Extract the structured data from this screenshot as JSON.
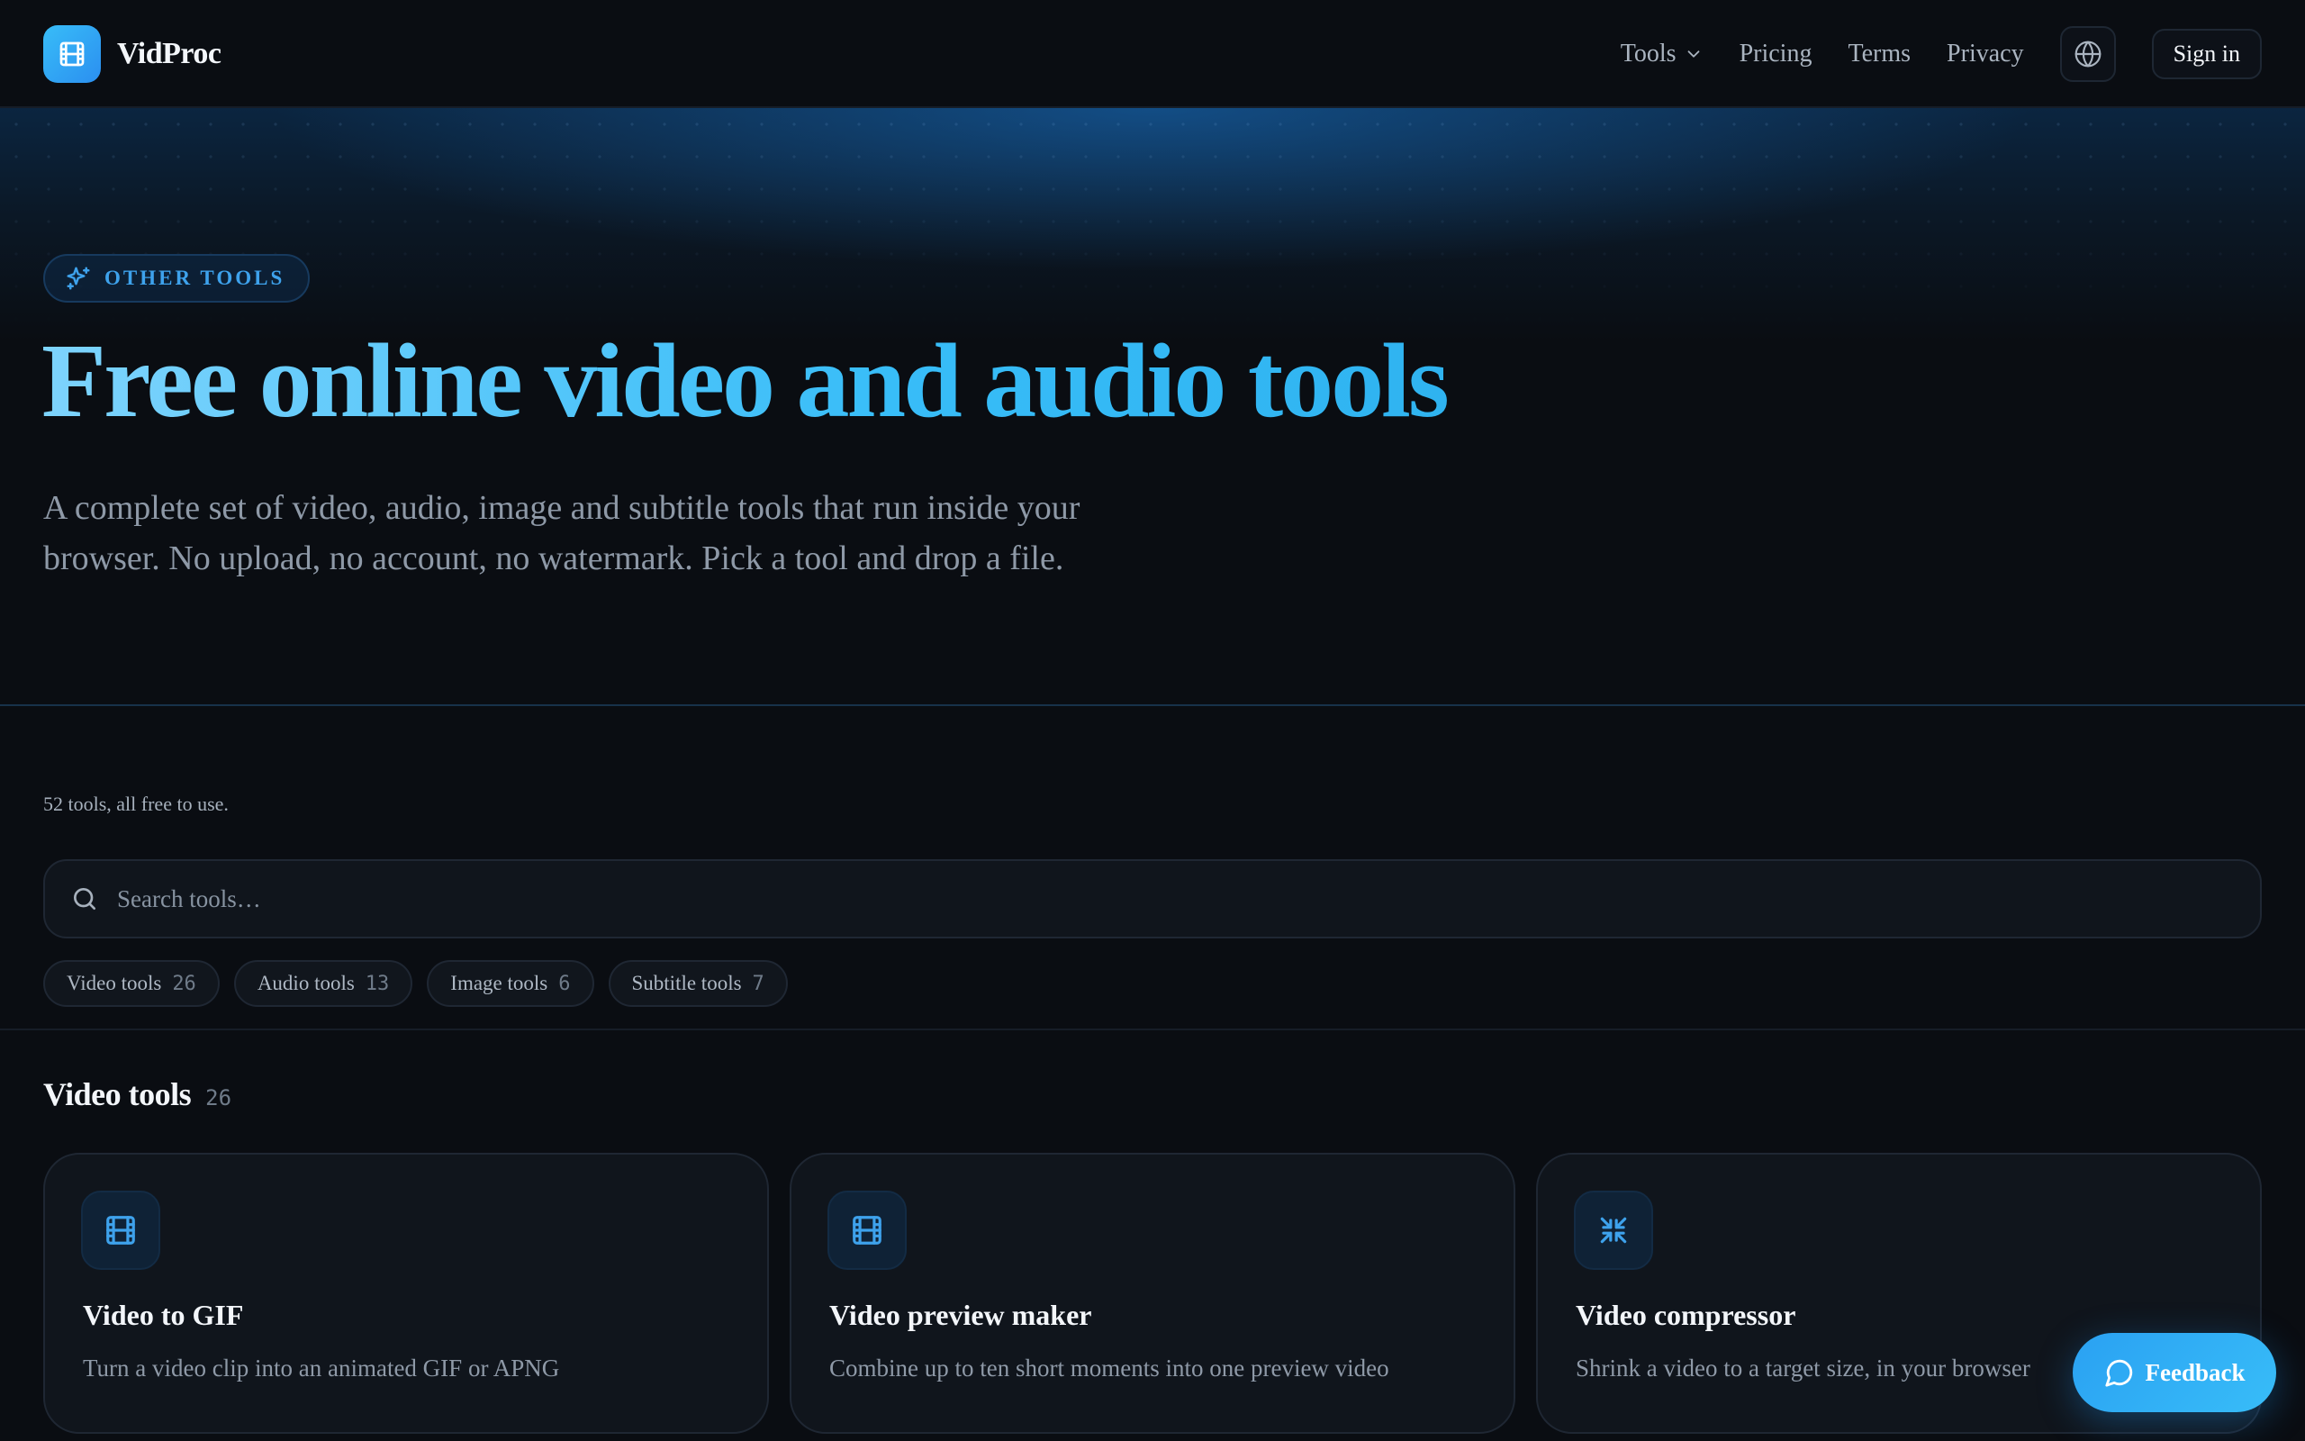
{
  "brand": {
    "name": "VidProc",
    "icon": "film-icon"
  },
  "nav": {
    "tools_label": "Tools",
    "pricing_label": "Pricing",
    "terms_label": "Terms",
    "privacy_label": "Privacy",
    "language_icon": "globe-icon",
    "signin_label": "Sign in"
  },
  "hero": {
    "badge": "OTHER TOOLS",
    "badge_icon": "sparkles-icon",
    "title": "Free online video and audio tools",
    "subtitle_line1": "A complete set of video, audio, image and subtitle tools that run inside your",
    "subtitle_line2": "browser. No upload, no account, no watermark. Pick a tool and drop a file."
  },
  "tools": {
    "count_note": "52 tools, all free to use.",
    "search": {
      "placeholder": "Search tools…",
      "value": "",
      "icon": "search-icon"
    },
    "filters": [
      {
        "label": "Video tools",
        "count": "26"
      },
      {
        "label": "Audio tools",
        "count": "13"
      },
      {
        "label": "Image tools",
        "count": "6"
      },
      {
        "label": "Subtitle tools",
        "count": "7"
      }
    ]
  },
  "video_section": {
    "title": "Video tools",
    "count": "26",
    "cards": [
      {
        "title": "Video to GIF",
        "description": "Turn a video clip into an animated GIF or APNG",
        "icon": "film-icon"
      },
      {
        "title": "Video preview maker",
        "description": "Combine up to ten short moments into one preview video",
        "icon": "film-icon"
      },
      {
        "title": "Video compressor",
        "description": "Shrink a video to a target size, in your browser",
        "icon": "compress-icon"
      }
    ]
  },
  "feedback": {
    "label": "Feedback",
    "icon": "chat-bubble-icon"
  },
  "colors": {
    "background": "#0a0d12",
    "accent": "#38bdf8",
    "card": "#10151c",
    "border": "#1f2733"
  }
}
